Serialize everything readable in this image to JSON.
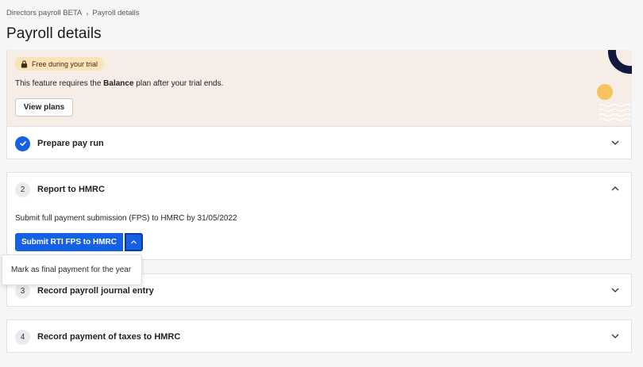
{
  "breadcrumb": {
    "parent": "Directors payroll BETA",
    "separator": "›",
    "current": "Payroll details"
  },
  "page": {
    "title": "Payroll details"
  },
  "trial_banner": {
    "badge": "Free during your trial",
    "text_before": "This feature requires the ",
    "plan_name": "Balance",
    "text_after": " plan after your trial ends.",
    "button": "View plans"
  },
  "steps": [
    {
      "number": "",
      "title": "Prepare pay run",
      "status": "complete",
      "expanded": false
    },
    {
      "number": "2",
      "title": "Report to HMRC",
      "status": "active",
      "expanded": true,
      "description": "Submit full payment submission (FPS) to HMRC by 31/05/2022",
      "primary_action": "Submit RTI FPS to HMRC",
      "dropdown_item": "Mark as final payment for the year"
    },
    {
      "number": "3",
      "title": "Record payroll journal entry",
      "expanded": false
    },
    {
      "number": "4",
      "title": "Record payment of taxes to HMRC",
      "expanded": false
    }
  ],
  "colors": {
    "primary": "#1560e5",
    "banner_bg": "#f5ede6",
    "badge_bg": "#fbe3b8",
    "deco_navy": "#0f1a3d",
    "deco_yellow": "#f7c35f"
  }
}
